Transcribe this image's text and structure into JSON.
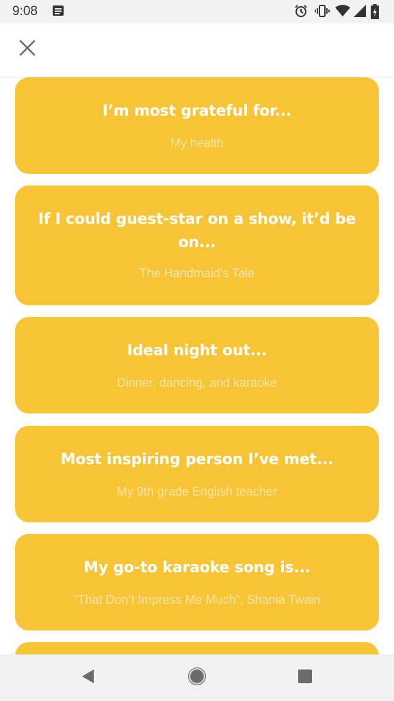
{
  "status_bar": {
    "time": "9:08",
    "icons": [
      "notification-icon",
      "alarm-icon",
      "vibrate-icon",
      "wifi-icon",
      "signal-icon",
      "battery-icon"
    ]
  },
  "header": {
    "close_icon": "close-icon"
  },
  "colors": {
    "card_background": "#f7c436",
    "question_text": "#ffffff",
    "answer_text": "#fbe6a8"
  },
  "cards": [
    {
      "question": "I’m most grateful for...",
      "answer": "My health"
    },
    {
      "question": "If I could guest-star on a show, it’d be on...",
      "answer": "The Handmaid’s Tale"
    },
    {
      "question": "Ideal night out...",
      "answer": "Dinner, dancing, and karaoke"
    },
    {
      "question": "Most inspiring person I’ve met...",
      "answer": "My 9th grade English teacher"
    },
    {
      "question": "My go-to karaoke song is...",
      "answer": "“That Don’t Impress Me Much”, Shania Twain"
    }
  ],
  "nav_bar": {
    "buttons": [
      "back-icon",
      "home-icon",
      "recents-icon"
    ]
  }
}
